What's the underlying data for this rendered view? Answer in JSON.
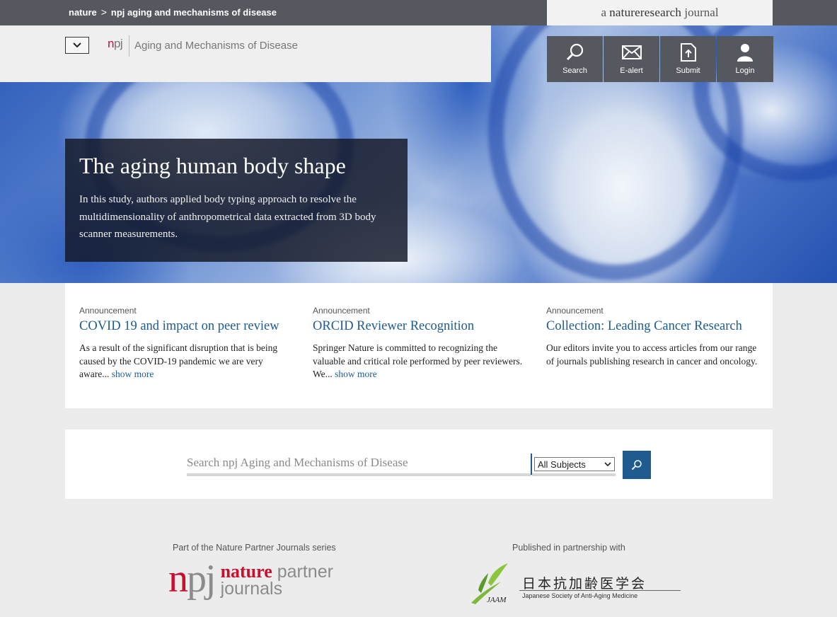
{
  "breadcrumb": {
    "home": "nature",
    "separator": ">",
    "current": "npj aging and mechanisms of disease"
  },
  "badge": {
    "prefix": "a",
    "brand": "natureresearch",
    "suffix": "journal"
  },
  "header": {
    "logo_n": "n",
    "logo_pj": "pj",
    "journal_name": "Aging and Mechanisms of Disease"
  },
  "tools": [
    {
      "label": "Search",
      "icon": "search-icon"
    },
    {
      "label": "E-alert",
      "icon": "envelope-icon"
    },
    {
      "label": "Submit",
      "icon": "upload-icon"
    },
    {
      "label": "Login",
      "icon": "user-icon"
    }
  ],
  "feature": {
    "title": "The aging human body shape",
    "summary": "In this study, authors applied body typing approach to resolve the multidimensionality of anthropometrical data extracted from 3D body scanner measurements."
  },
  "announcements": [
    {
      "kicker": "Announcement",
      "title": "COVID 19 and impact on peer review",
      "text": "As a result of the significant disruption that is being caused by the COVID-19 pandemic we are very aware...",
      "more": "show more"
    },
    {
      "kicker": "Announcement",
      "title": "ORCID Reviewer Recognition",
      "text": "Springer Nature is committed to recognizing the valuable and critical role performed by peer reviewers. We...",
      "more": "show more"
    },
    {
      "kicker": "Announcement",
      "title": "Collection: Leading Cancer Research",
      "text": "Our editors invite you to access articles from our range of journals publishing research in cancer and oncology.",
      "more": ""
    }
  ],
  "search": {
    "placeholder": "Search npj Aging and Mechanisms of Disease",
    "subject_selected": "All Subjects"
  },
  "partners": {
    "series_label": "Part of the Nature Partner Journals series",
    "npj_n": "n",
    "npj_pj": "pj",
    "npj_nature": "nature",
    "npj_partner": "partner",
    "npj_journals": "journals",
    "partnership_label": "Published in partnership with",
    "jaam_kanji": "日本抗加齢医学会",
    "jaam_english": "Japanese Society of Anti-Aging Medicine",
    "jaam_abbr": "JAAM"
  },
  "colors": {
    "accent": "#1f5b8e",
    "brand_red": "#c8102e",
    "topbar": "#55585f"
  }
}
